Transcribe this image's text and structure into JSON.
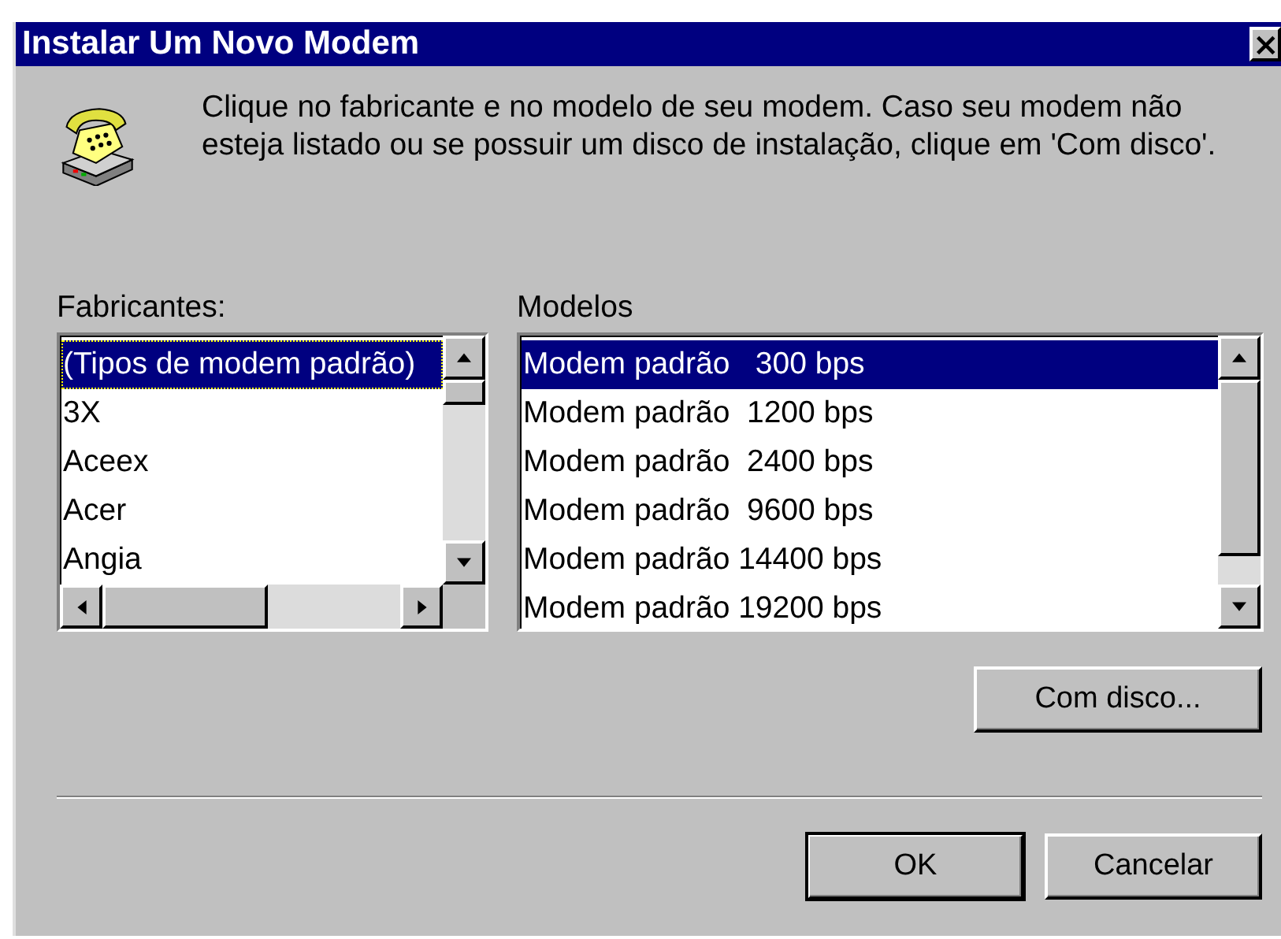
{
  "window": {
    "title": "Instalar Um Novo Modem",
    "close": "×"
  },
  "instructions": "Clique no fabricante e no modelo de seu modem. Caso seu modem não esteja listado ou se possuir um disco de instalação, clique em 'Com disco'.",
  "manufacturers": {
    "label": "Fabricantes:",
    "items": [
      {
        "text": "(Tipos de modem padrão)",
        "selected": true,
        "focused": true
      },
      {
        "text": "3X",
        "selected": false,
        "focused": false
      },
      {
        "text": "Aceex",
        "selected": false,
        "focused": false
      },
      {
        "text": "Acer",
        "selected": false,
        "focused": false
      },
      {
        "text": "Angia",
        "selected": false,
        "focused": false
      }
    ]
  },
  "models": {
    "label": "Modelos",
    "items": [
      {
        "text": "Modem padrão   300 bps",
        "selected": true,
        "focused": false
      },
      {
        "text": "Modem padrão  1200 bps",
        "selected": false,
        "focused": false
      },
      {
        "text": "Modem padrão  2400 bps",
        "selected": false,
        "focused": false
      },
      {
        "text": "Modem padrão  9600 bps",
        "selected": false,
        "focused": false
      },
      {
        "text": "Modem padrão 14400 bps",
        "selected": false,
        "focused": false
      },
      {
        "text": "Modem padrão 19200 bps",
        "selected": false,
        "focused": false
      }
    ]
  },
  "have_disk_button": {
    "label": "Com disco..."
  },
  "buttons": [
    {
      "label": "OK",
      "default": true
    },
    {
      "label": "Cancelar",
      "default": false
    }
  ]
}
